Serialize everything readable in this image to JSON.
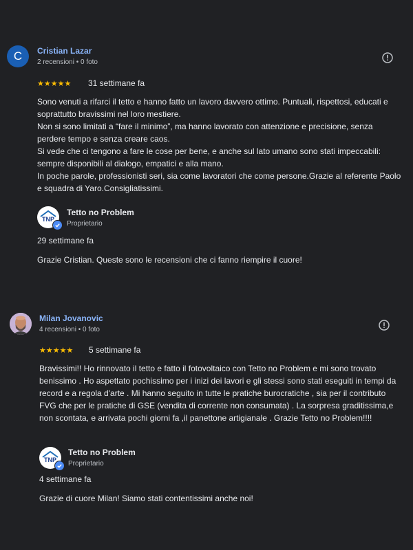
{
  "reviews": [
    {
      "avatar_letter": "C",
      "author": "Cristian Lazar",
      "meta": "2 recensioni • 0 foto",
      "stars": "★★★★★",
      "rating": 5,
      "time": "31 settimane fa",
      "text": [
        "Sono venuti a rifarci il tetto e hanno fatto un lavoro davvero ottimo. Puntuali, rispettosi, educati e soprattutto bravissimi nel loro mestiere.",
        "Non si sono limitati a “fare il minimo”, ma hanno lavorato con attenzione e precisione, senza perdere tempo e senza creare caos.",
        "Si vede che ci tengono a fare le cose per bene, e anche sul lato umano sono stati impeccabili: sempre disponibili al dialogo, empatici e alla mano.",
        "In poche parole, professionisti seri, sia come lavoratori che come persone.Grazie al referente Paolo e squadra di Yaro.Consigliatissimi."
      ],
      "owner_name": "Tetto no Problem",
      "owner_role": "Proprietario",
      "owner_logo_text": "TNP",
      "reply_time": "29 settimane fa",
      "reply_text": "Grazie Cristian. Queste sono le recensioni che ci fanno riempire il cuore!"
    },
    {
      "author": "Milan Jovanovic",
      "meta": "4 recensioni • 0 foto",
      "stars": "★★★★★",
      "rating": 5,
      "time": "5 settimane fa",
      "text": [
        "Bravissimi!! Ho rinnovato il tetto e fatto il fotovoltaico con Tetto no Problem e mi sono trovato benissimo . Ho aspettato pochissimo per i inizi dei lavori e gli stessi sono stati eseguiti in tempi da record e a regola d'arte . Mi hanno seguito in tutte le pratiche burocratiche , sia per il contributo FVG che per le pratiche di GSE (vendita di corrente non consumata) . La sorpresa graditissima,e non scontata, e arrivata pochi giorni fa ,il panettone artigianale . Grazie Tetto no Problem!!!!"
      ],
      "owner_name": "Tetto no Problem",
      "owner_role": "Proprietario",
      "owner_logo_text": "TNP",
      "reply_time": "4 settimane fa",
      "reply_text": "Grazie di cuore Milan! Siamo stati contentissimi anche noi!"
    }
  ],
  "colors": {
    "background": "#202124",
    "author_link": "#8ab4f8",
    "star": "#fbbc04",
    "avatar_letter_bg": "#1a5fb4",
    "verified_badge": "#4c8bf5"
  },
  "icons": {
    "flag": "flag-icon",
    "verified": "verified-check-icon",
    "avatar_photo": "person-avatar-photo"
  }
}
